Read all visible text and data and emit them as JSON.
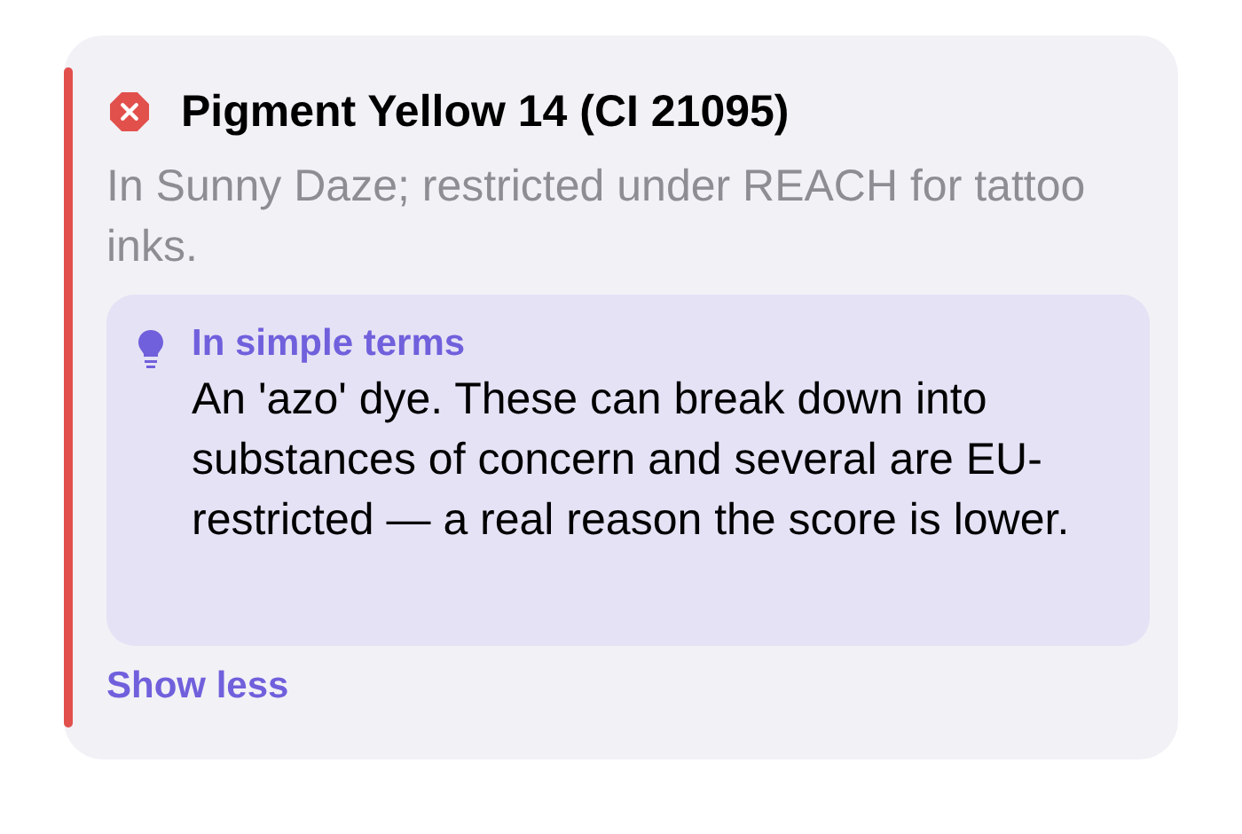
{
  "ingredient": {
    "flagged": true,
    "name": "Pigment Yellow 14 (CI 21095)",
    "note": "In Sunny Daze; restricted under REACH for tattoo inks.",
    "expanded": true,
    "explainer": {
      "heading": "In simple terms",
      "body": "An 'azo' dye. These can break down into substances of concern and several are EU-restricted — a real reason the score is lower."
    },
    "toggle": "Show less"
  }
}
